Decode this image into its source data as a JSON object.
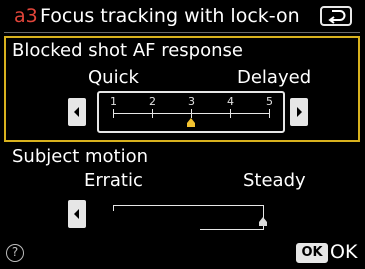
{
  "header": {
    "menu_code": "a3",
    "title": "Focus tracking with lock-on",
    "back_icon": "back-return-icon"
  },
  "settings": [
    {
      "label": "Blocked shot AF response",
      "left_label": "Quick",
      "right_label": "Delayed",
      "scale": [
        "1",
        "2",
        "3",
        "4",
        "5"
      ],
      "value": 3,
      "highlighted": true
    },
    {
      "label": "Subject motion",
      "left_label": "Erratic",
      "right_label": "Steady",
      "value_position": "steady-end",
      "highlighted": false
    }
  ],
  "footer": {
    "help_symbol": "?",
    "ok_badge": "OK",
    "ok_label": "OK"
  },
  "colors": {
    "menu_code": "#e2453a",
    "highlight_border": "#d9b21e",
    "indicator": "#f2c230",
    "background": "#000000"
  }
}
